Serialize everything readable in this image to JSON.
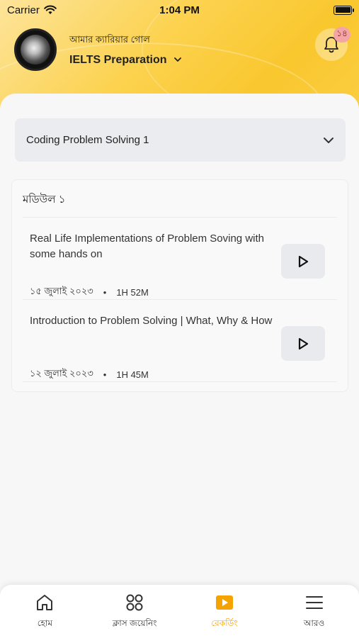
{
  "status_bar": {
    "carrier": "Carrier",
    "time": "1:04 PM"
  },
  "header": {
    "subtitle": "আমার ক্যারিয়ার গোল",
    "title": "IELTS Preparation",
    "notification_count": "১৪"
  },
  "course_selector": {
    "value": "Coding Problem Solving 1"
  },
  "module": {
    "title": "মডিউল ১",
    "lessons": [
      {
        "title": "Real Life Implementations of Problem Soving with some hands on",
        "date": "১৫ জুলাই ২০২৩",
        "separator": "•",
        "duration": "1H 52M"
      },
      {
        "title": "Introduction to Problem Solving | What, Why & How",
        "date": "১২ জুলাই ২০২৩",
        "separator": "•",
        "duration": "1H 45M"
      }
    ]
  },
  "tabbar": {
    "items": [
      {
        "label": "হোম",
        "icon": "home-icon"
      },
      {
        "label": "ক্লাস জয়েনিং",
        "icon": "grid-circles-icon"
      },
      {
        "label": "রেকর্ডিং",
        "icon": "play-square-icon"
      },
      {
        "label": "আরও",
        "icon": "menu-icon"
      }
    ],
    "active_index": 2,
    "active_color": "#f5a300"
  },
  "colors": {
    "header_yellow": "#fcd24f",
    "badge_bg": "#f4a5a5"
  }
}
